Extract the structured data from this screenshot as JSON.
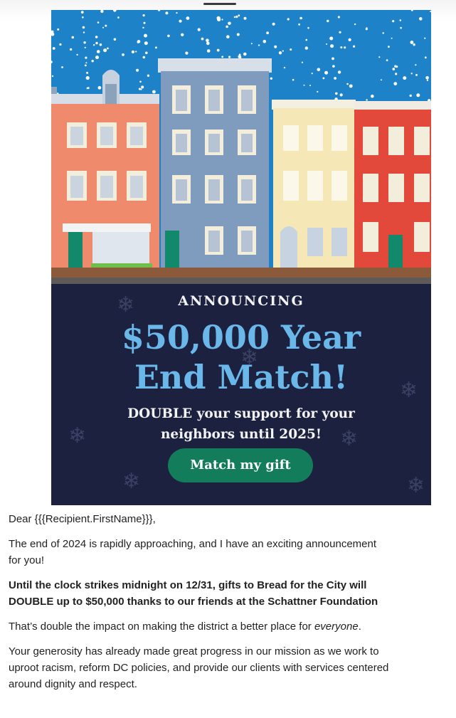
{
  "banner": {
    "announcing": "ANNOUNCING",
    "headline_line1": "$50,000 Year",
    "headline_line2": "End Match!",
    "subline_line1": "DOUBLE your support for your",
    "subline_line2": "neighbors until 2025!",
    "cta_label": "Match my gift",
    "colors": {
      "navy": "#1c2140",
      "sky": "#1d82c8",
      "headline": "#6ab7ea",
      "cta": "#137c5a"
    }
  },
  "email": {
    "greeting": "Dear {{{Recipient.FirstName}}},",
    "para1_line1": "The end of 2024 is rapidly approaching, and I have an exciting announcement",
    "para1_line2": "for you!",
    "para2_line1": "Until the clock strikes midnight on 12/31, gifts to Bread for the City will",
    "para2_line2": "DOUBLE up to $50,000 thanks to our friends at the Schattner Foundation",
    "para3_before": "That’s double the impact on making the district a better place for ",
    "para3_em": "everyone",
    "para3_after": ".",
    "para4_line1": "Your generosity has already made great progress in our mission as we work to",
    "para4_line2": "uproot racism, reform DC policies, and provide our clients with services centered",
    "para4_line3": "around dignity and respect."
  }
}
